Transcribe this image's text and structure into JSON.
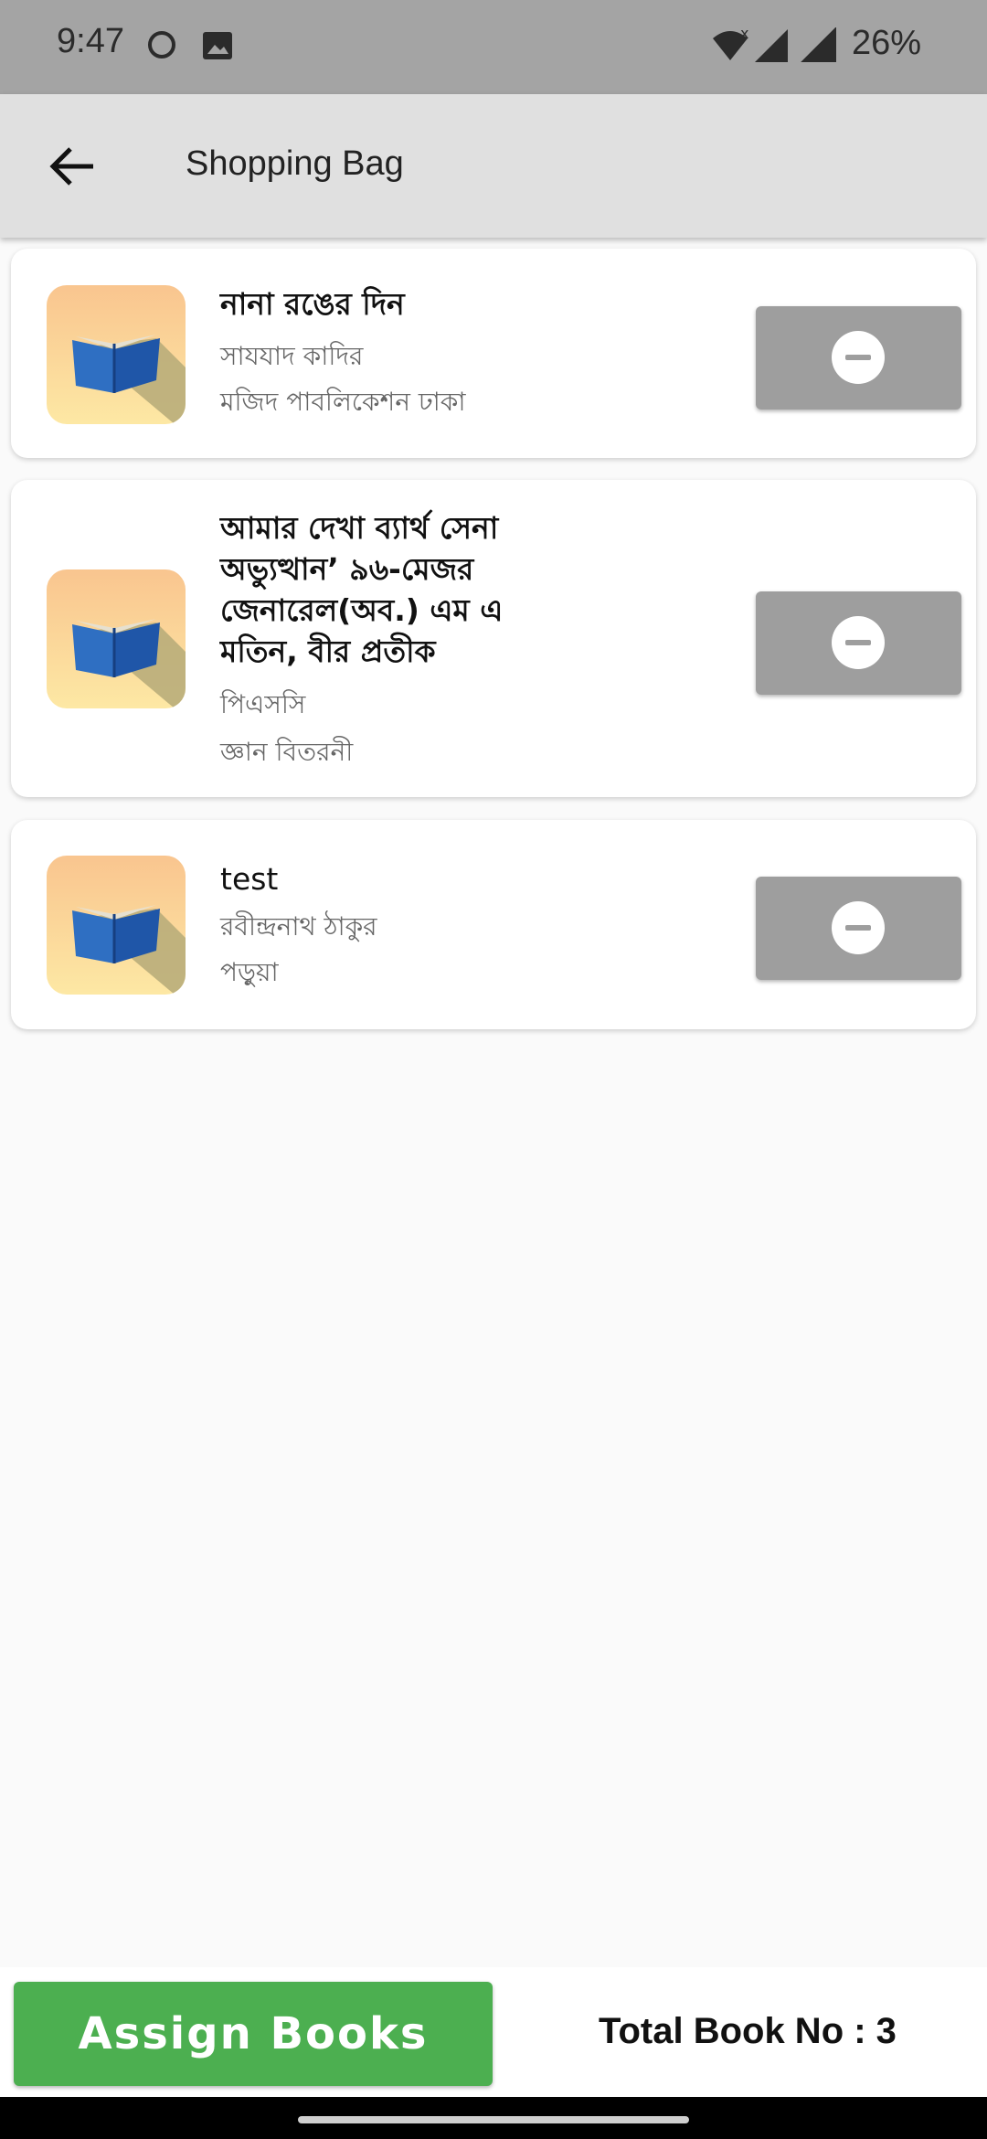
{
  "status_bar": {
    "time": "9:47",
    "battery": "26%"
  },
  "app_bar": {
    "title": "Shopping Bag"
  },
  "books": [
    {
      "title": "নানা রঙের দিন",
      "author": "সাযযাদ কাদির",
      "publisher": "মজিদ পাবলিকেশন ঢাকা"
    },
    {
      "title": "আমার দেখা ব্যার্থ সেনা অভ্যুত্থান’ ৯৬-মেজর জেনারেল(অব.) এম এ মতিন, বীর প্রতীক",
      "author": "পিএসসি",
      "publisher": "জ্ঞান বিতরনী"
    },
    {
      "title": "test",
      "author": "রবীন্দ্রনাথ ঠাকুর",
      "publisher": "পড়ুয়া"
    }
  ],
  "footer": {
    "assign_label": "Assign Books",
    "total_label": "Total Book No : 3"
  },
  "colors": {
    "app_bar": "#e0e0e0",
    "status_bar": "#a4a4a4",
    "assign_button": "#4caf50",
    "remove_button": "#9e9e9e"
  },
  "icons": {
    "back": "arrow-back-icon",
    "remove": "minus-circle-icon",
    "thumbnail": "open-book-icon"
  }
}
